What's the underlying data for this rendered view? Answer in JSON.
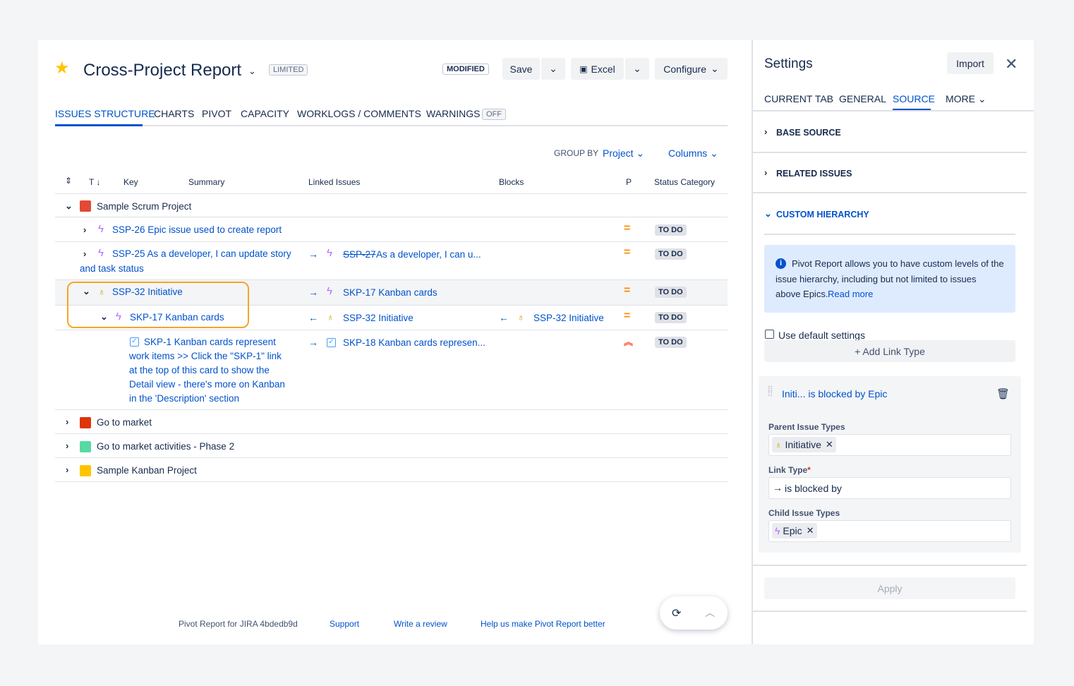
{
  "header": {
    "title": "Cross-Project Report",
    "limited": "LIMITED",
    "modified": "MODIFIED",
    "save": "Save",
    "excel": "Excel",
    "configure": "Configure"
  },
  "tabs": [
    "ISSUES STRUCTURE",
    "CHARTS",
    "PIVOT",
    "CAPACITY",
    "WORKLOGS / COMMENTS",
    "WARNINGS"
  ],
  "warnings_badge": "OFF",
  "group_by": {
    "label": "GROUP BY",
    "value": "Project",
    "columns": "Columns"
  },
  "columns": {
    "t": "T",
    "key": "Key",
    "summary": "Summary",
    "linked": "Linked Issues",
    "blocks": "Blocks",
    "p": "P",
    "status": "Status Category"
  },
  "rows": {
    "ssp": "Sample Scrum Project",
    "r1": {
      "text": "SSP-26 Epic issue used to create report",
      "status": "TO DO"
    },
    "r2": {
      "text1": "SSP-25 As a developer, I can update story",
      "text2": "and task status",
      "linked_key": "SSP-27",
      "linked_rest": "As a developer, I can u...",
      "status": "TO DO"
    },
    "r3": {
      "text": "SSP-32 Initiative",
      "linked": "SKP-17 Kanban cards",
      "status": "TO DO"
    },
    "r4": {
      "text": "SKP-17 Kanban cards",
      "linked": "SSP-32 Initiative",
      "blocks": "SSP-32 Initiative",
      "status": "TO DO"
    },
    "r5": {
      "l1": "SKP-1 Kanban cards represent",
      "l2": "work items >> Click the \"SKP-1\" link",
      "l3": "at the top of this card to show the",
      "l4": "Detail view - there's more on Kanban",
      "l5": "in the 'Description' section",
      "linked": "SKP-18 Kanban cards represen...",
      "status": "TO DO"
    },
    "g1": "Go to market",
    "g2": "Go to market activities - Phase 2",
    "g3": "Sample Kanban Project"
  },
  "footer": {
    "brand": "Pivot Report for JIRA 4bdedb9d",
    "support": "Support",
    "review": "Write a review",
    "help": "Help us make Pivot Report better"
  },
  "settings": {
    "title": "Settings",
    "import": "Import",
    "tabs": [
      "CURRENT TAB",
      "GENERAL",
      "SOURCE",
      "MORE"
    ],
    "base_source": "BASE SOURCE",
    "related": "RELATED ISSUES",
    "custom": "CUSTOM HIERARCHY",
    "info1": "Pivot Report allows you to have custom levels of the",
    "info2": "issue hierarchy, including but not limited to issues",
    "info3": "above Epics.",
    "read_more": "Read more",
    "use_default": "Use default settings",
    "add_link": "+ Add Link Type",
    "rule_title": "Initi... is blocked by Epic",
    "parent_label": "Parent Issue Types",
    "parent_tag": "Initiative",
    "link_label": "Link Type",
    "link_value": "is blocked by",
    "child_label": "Child Issue Types",
    "child_tag": "Epic",
    "apply": "Apply"
  },
  "colors": {
    "accent": "#0052cc",
    "highlight": "#f5a623",
    "epic": "#b468ff",
    "initiative": "#d29b00",
    "priority": "#ff8b00"
  }
}
